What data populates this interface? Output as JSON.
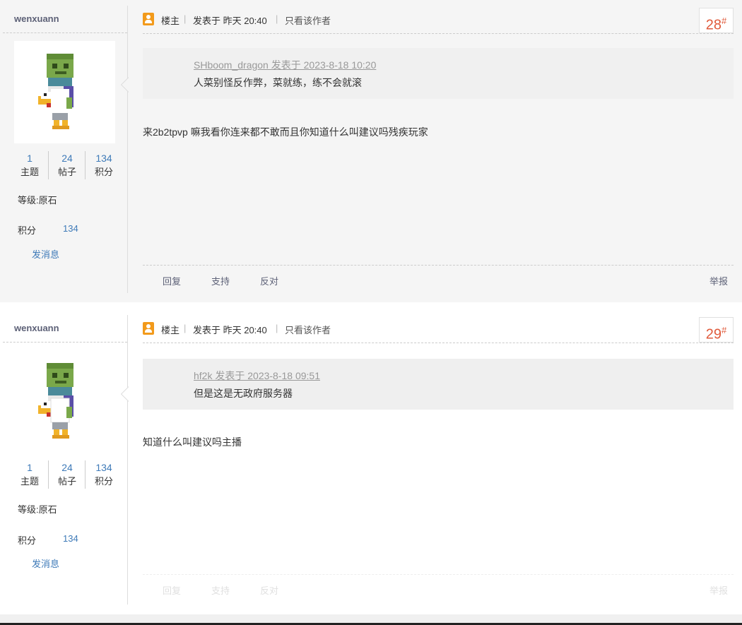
{
  "posts": [
    {
      "author": "wenxuann",
      "stats": [
        {
          "num": "1",
          "label": "主题"
        },
        {
          "num": "24",
          "label": "帖子"
        },
        {
          "num": "134",
          "label": "积分"
        }
      ],
      "level": "等级:原石",
      "score_label": "积分",
      "score_value": "134",
      "send_msg": "发消息",
      "op_label": "楼主",
      "posted": "发表于 昨天 20:40",
      "only_author": "只看该作者",
      "floor": "28",
      "floor_mark": "#",
      "quote_head": "SHboom_dragon 发表于 2023-8-18 10:20",
      "quote_body": "人菜别怪反作弊，菜就练，练不会就滚",
      "content": "来2b2tpvp 嘛我看你连来都不敢而且你知道什么叫建议吗残疾玩家",
      "actions": {
        "reply": "回复",
        "support": "支持",
        "oppose": "反对",
        "report": "举报"
      }
    },
    {
      "author": "wenxuann",
      "stats": [
        {
          "num": "1",
          "label": "主题"
        },
        {
          "num": "24",
          "label": "帖子"
        },
        {
          "num": "134",
          "label": "积分"
        }
      ],
      "level": "等级:原石",
      "score_label": "积分",
      "score_value": "134",
      "send_msg": "发消息",
      "op_label": "楼主",
      "posted": "发表于 昨天 20:40",
      "only_author": "只看该作者",
      "floor": "29",
      "floor_mark": "#",
      "quote_head": "hf2k 发表于 2023-8-18 09:51",
      "quote_body": "但是这是无政府服务器",
      "content": "知道什么叫建议吗主播",
      "actions": {
        "reply": "回复",
        "support": "支持",
        "oppose": "反对",
        "report": "举报"
      }
    }
  ],
  "colors": {
    "accent": "#3e7ab8",
    "floor": "#e05a3b",
    "op_icon": "#f29a1b"
  }
}
